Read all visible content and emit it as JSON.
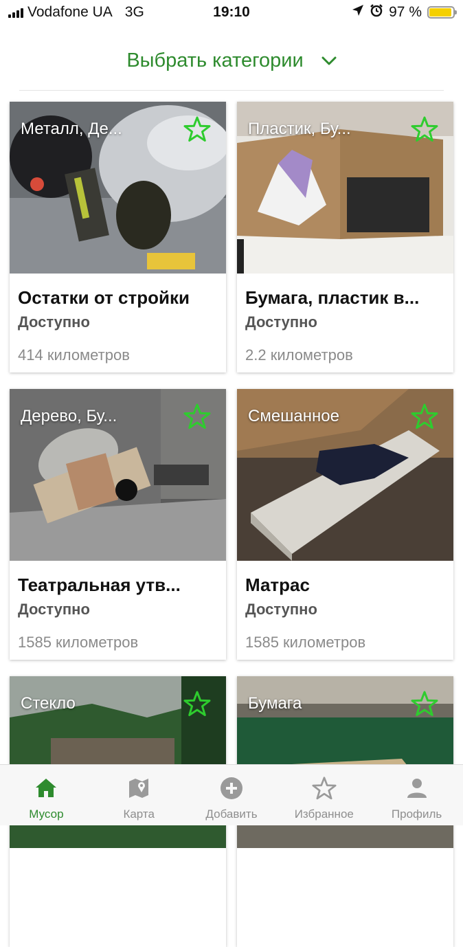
{
  "status_bar": {
    "carrier": "Vodafone UA",
    "network": "3G",
    "time": "19:10",
    "battery": "97 %",
    "battery_level": 0.97
  },
  "header": {
    "category_label": "Выбрать категории"
  },
  "cards": [
    {
      "category": "Металл, Де...",
      "title": "Остатки от стройки",
      "status": "Доступно",
      "distance": "414 километров"
    },
    {
      "category": "Пластик, Бу...",
      "title": "Бумага, пластик в...",
      "status": "Доступно",
      "distance": "2.2 километров"
    },
    {
      "category": "Дерево, Бу...",
      "title": "Театральная  утв...",
      "status": "Доступно",
      "distance": "1585 километров"
    },
    {
      "category": "Смешанное",
      "title": "Матрас",
      "status": "Доступно",
      "distance": "1585 километров"
    },
    {
      "category": "Стекло",
      "title": "",
      "status": "",
      "distance": ""
    },
    {
      "category": "Бумага",
      "title": "",
      "status": "",
      "distance": ""
    }
  ],
  "nav": {
    "items": [
      {
        "label": "Мусор",
        "icon": "home-icon",
        "active": true
      },
      {
        "label": "Карта",
        "icon": "map-icon",
        "active": false
      },
      {
        "label": "Добавить",
        "icon": "add-icon",
        "active": false
      },
      {
        "label": "Избранное",
        "icon": "star-icon",
        "active": false
      },
      {
        "label": "Профиль",
        "icon": "person-icon",
        "active": false
      }
    ]
  },
  "colors": {
    "accent": "#2e8b2e",
    "star": "#2ecc2e",
    "inactive": "#8e8e8e",
    "battery": "#f5d000"
  }
}
